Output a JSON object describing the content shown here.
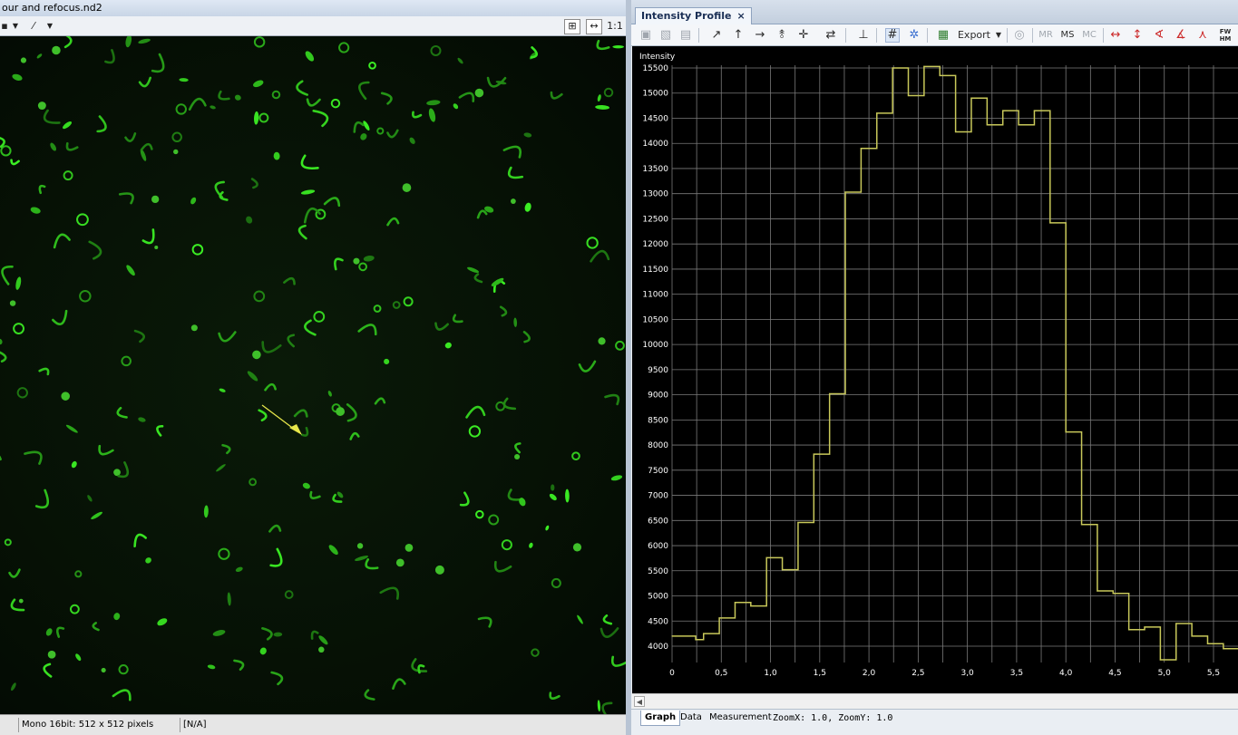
{
  "left_window": {
    "title": "our and refocus.nd2",
    "zoom_label": "1:1",
    "status": {
      "image_info": "Mono 16bit: 512 x 512 pixels",
      "value": "[N/A]"
    }
  },
  "right_window": {
    "tab_label": "Intensity Profile",
    "tab_close": "×",
    "toolbar": {
      "export_label": "Export",
      "mr_label": "MR",
      "ms_label": "MS",
      "mc_label": "MC",
      "fwhm_label": "FW HM"
    },
    "bottom_tabs": {
      "graph": "Graph",
      "data": "Data",
      "measurement": "Measurement"
    },
    "zoom_readout": "ZoomX: 1.0, ZoomY: 1.0"
  },
  "colors": {
    "profile_line": "#c8c85a",
    "grid": "#7a7a7a",
    "arrow": "#e6e64a",
    "cell_green": "#3fbf2a"
  },
  "chart_data": {
    "type": "line",
    "step": true,
    "ylabel": "Intensity",
    "xlabel": "",
    "xlim": [
      0,
      5.82
    ],
    "ylim": [
      3700,
      15600
    ],
    "x_ticks": [
      "0",
      "0,5",
      "1,0",
      "1,5",
      "2,0",
      "2,5",
      "3,0",
      "3,5",
      "4,0",
      "4,5",
      "5,0",
      "5,5"
    ],
    "x_tick_values": [
      0,
      0.5,
      1.0,
      1.5,
      2.0,
      2.5,
      3.0,
      3.5,
      4.0,
      4.5,
      5.0,
      5.5
    ],
    "y_ticks": [
      "4000",
      "4500",
      "5000",
      "5500",
      "6000",
      "6500",
      "7000",
      "7500",
      "8000",
      "8500",
      "9000",
      "9500",
      "10000",
      "10500",
      "11000",
      "11500",
      "12000",
      "12500",
      "13000",
      "13500",
      "14000",
      "14500",
      "15000",
      "15500"
    ],
    "y_tick_values": [
      4000,
      4500,
      5000,
      5500,
      6000,
      6500,
      7000,
      7500,
      8000,
      8500,
      9000,
      9500,
      10000,
      10500,
      11000,
      11500,
      12000,
      12500,
      13000,
      13500,
      14000,
      14500,
      15000,
      15500
    ],
    "grid": true,
    "series": [
      {
        "x": [
          0,
          0.24,
          0.32,
          0.48,
          0.64,
          0.8,
          0.96,
          1.12,
          1.28,
          1.44,
          1.6,
          1.76,
          1.92,
          2.08,
          2.24,
          2.4,
          2.56,
          2.72,
          2.88,
          3.04,
          3.2,
          3.36,
          3.52,
          3.68,
          3.84,
          4.0,
          4.16,
          4.32,
          4.48,
          4.64,
          4.8,
          4.96,
          5.12,
          5.28,
          5.44,
          5.6,
          5.76
        ],
        "y": [
          4200,
          4130,
          4250,
          4560,
          4870,
          4800,
          5760,
          5520,
          6460,
          7820,
          9020,
          13030,
          13900,
          14600,
          15500,
          14950,
          15530,
          15350,
          14230,
          14900,
          14370,
          14650,
          14370,
          14650,
          12420,
          8260,
          6420,
          5100,
          5050,
          4330,
          4380,
          3730,
          4450,
          4200,
          4050,
          3950,
          3950
        ]
      }
    ]
  }
}
